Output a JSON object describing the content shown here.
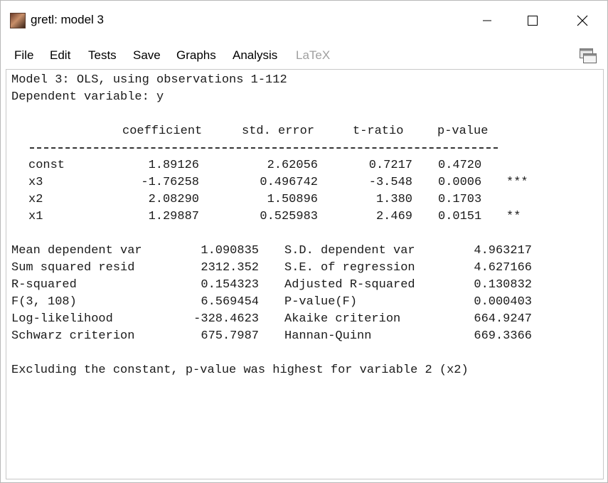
{
  "window": {
    "title": "gretl: model 3"
  },
  "menu": {
    "file": "File",
    "edit": "Edit",
    "tests": "Tests",
    "save": "Save",
    "graphs": "Graphs",
    "analysis": "Analysis",
    "latex": "LaTeX"
  },
  "icons": {
    "app": "gretl-app-icon",
    "minimize": "minimize-icon",
    "maximize": "maximize-icon",
    "close": "close-icon",
    "windows": "windows-stack-icon"
  },
  "output": {
    "header_line1": "Model 3: OLS, using observations 1-112",
    "header_line2": "Dependent variable: y",
    "columns": {
      "coefficient": "coefficient",
      "std_error": "std. error",
      "t_ratio": "t-ratio",
      "p_value": "p-value"
    },
    "rows": [
      {
        "name": "const",
        "coef": "1.89126",
        "se": "2.62056",
        "t": "0.7217",
        "p": "0.4720",
        "stars": ""
      },
      {
        "name": "x3",
        "coef": "-1.76258",
        "se": "0.496742",
        "t": "-3.548",
        "p": "0.0006",
        "stars": "***"
      },
      {
        "name": "x2",
        "coef": "2.08290",
        "se": "1.50896",
        "t": "1.380",
        "p": "0.1703",
        "stars": ""
      },
      {
        "name": "x1",
        "coef": "1.29887",
        "se": "0.525983",
        "t": "2.469",
        "p": "0.0151",
        "stars": "**"
      }
    ],
    "stats": [
      {
        "l_label": "Mean dependent var",
        "l_value": "1.090835",
        "r_label": "S.D. dependent var",
        "r_value": "4.963217"
      },
      {
        "l_label": "Sum squared resid",
        "l_value": "2312.352",
        "r_label": "S.E. of regression",
        "r_value": "4.627166"
      },
      {
        "l_label": "R-squared",
        "l_value": "0.154323",
        "r_label": "Adjusted R-squared",
        "r_value": "0.130832"
      },
      {
        "l_label": "F(3, 108)",
        "l_value": "6.569454",
        "r_label": "P-value(F)",
        "r_value": "0.000403"
      },
      {
        "l_label": "Log-likelihood",
        "l_value": "-328.4623",
        "r_label": "Akaike criterion",
        "r_value": "664.9247"
      },
      {
        "l_label": "Schwarz criterion",
        "l_value": "675.7987",
        "r_label": "Hannan-Quinn",
        "r_value": "669.3366"
      }
    ],
    "footer": "Excluding the constant, p-value was highest for variable 2 (x2)"
  }
}
